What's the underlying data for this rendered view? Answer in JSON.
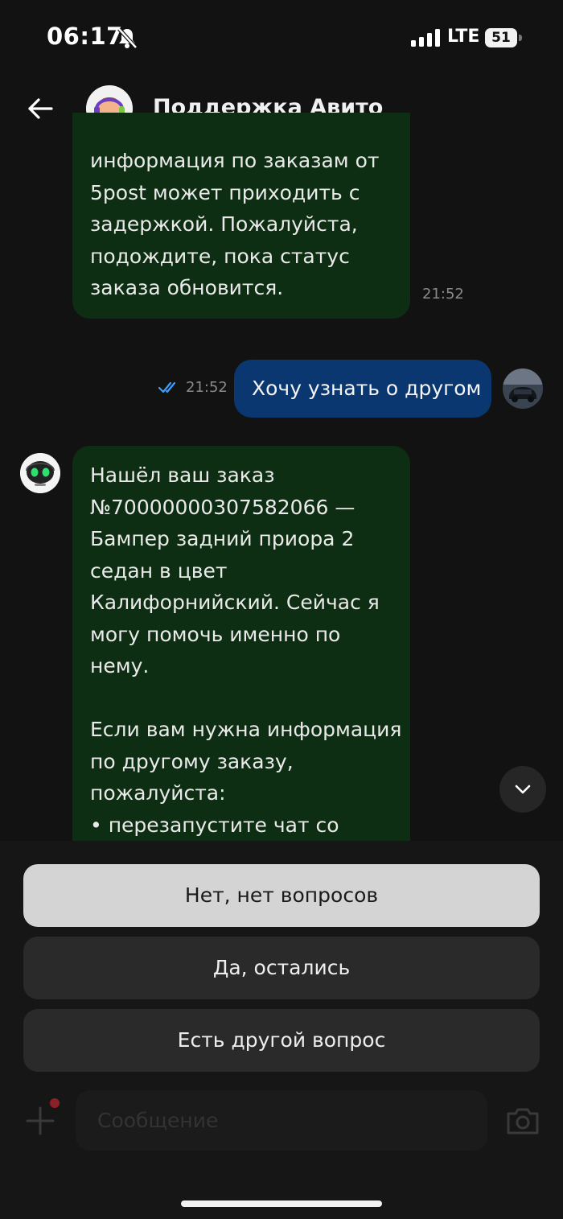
{
  "status_bar": {
    "time": "06:17",
    "network": "LTE",
    "battery": "51"
  },
  "header": {
    "title": "Поддержка Авито",
    "icons": {
      "back": "arrow-left-icon",
      "avatar": "support-agent-avatar"
    }
  },
  "messages": [
    {
      "direction": "incoming",
      "lines": [
        "информация по заказам от",
        "5post может приходить с",
        "задержкой. Пожалуйста,",
        "подождите, пока статус",
        "заказа обновится."
      ],
      "time": "21:52"
    },
    {
      "direction": "outgoing",
      "text": "Хочу узнать о другом",
      "time": "21:52",
      "status": "read"
    },
    {
      "direction": "incoming",
      "lines": [
        "Нашёл ваш заказ",
        "№70000000307582066 —",
        "Бампер задний приора 2",
        "седан в цвет",
        "Калифорнийский. Сейчас я",
        "могу помочь именно по",
        "нему.",
        "",
        "Если вам нужна информация",
        "по другому заказу,",
        "пожалуйста:",
        "• перезапустите чат со"
      ]
    }
  ],
  "quick_replies": [
    "Нет, нет вопросов",
    "Да, остались",
    "Есть другой вопрос"
  ],
  "composer": {
    "placeholder": "Сообщение"
  },
  "colors": {
    "background": "#121212",
    "incoming_bubble": "#0d2e12",
    "outgoing_bubble": "#0a3770",
    "read_check": "#3aa0ff",
    "selected_reply": "#d4d4d4"
  }
}
